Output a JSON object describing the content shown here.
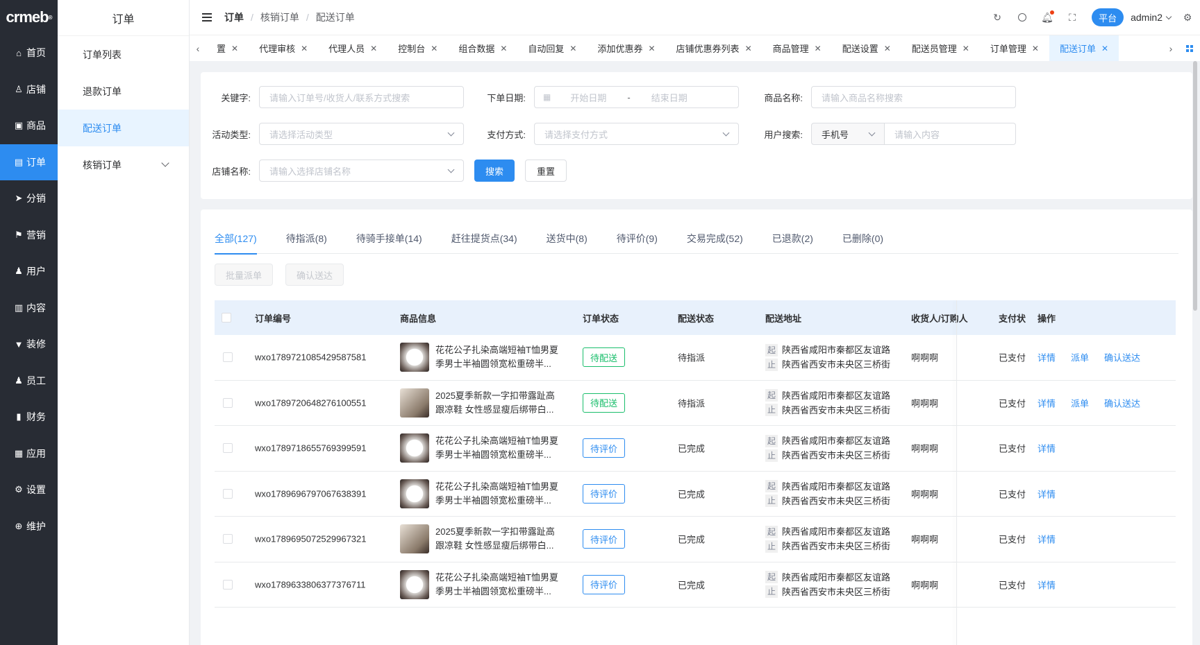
{
  "logo": "crmeb",
  "nav1": [
    {
      "label": "首页",
      "icon": "home-icon",
      "glyph": "⌂"
    },
    {
      "label": "店铺",
      "icon": "store-icon",
      "glyph": "♙"
    },
    {
      "label": "商品",
      "icon": "goods-icon",
      "glyph": "▣"
    },
    {
      "label": "订单",
      "icon": "order-icon",
      "glyph": "▤",
      "active": true
    },
    {
      "label": "分销",
      "icon": "distribution-icon",
      "glyph": "➤"
    },
    {
      "label": "营销",
      "icon": "flag-icon",
      "glyph": "⚑"
    },
    {
      "label": "用户",
      "icon": "user-icon",
      "glyph": "♟"
    },
    {
      "label": "内容",
      "icon": "book-icon",
      "glyph": "▥"
    },
    {
      "label": "装修",
      "icon": "brush-icon",
      "glyph": "▼"
    },
    {
      "label": "员工",
      "icon": "staff-icon",
      "glyph": "♟"
    },
    {
      "label": "财务",
      "icon": "chart-icon",
      "glyph": "▮"
    },
    {
      "label": "应用",
      "icon": "apps-icon",
      "glyph": "▦"
    },
    {
      "label": "设置",
      "icon": "gear-icon",
      "glyph": "⚙"
    },
    {
      "label": "维护",
      "icon": "maintain-icon",
      "glyph": "⊕"
    }
  ],
  "nav2": {
    "title": "订单",
    "items": [
      {
        "label": "订单列表"
      },
      {
        "label": "退款订单"
      },
      {
        "label": "配送订单",
        "active": true
      },
      {
        "label": "核销订单",
        "expandable": true
      }
    ]
  },
  "breadcrumb": [
    "订单",
    "核销订单",
    "配送订单"
  ],
  "header": {
    "platform": "平台",
    "user": "admin2"
  },
  "tabs": [
    {
      "label": "置"
    },
    {
      "label": "代理审核"
    },
    {
      "label": "代理人员"
    },
    {
      "label": "控制台"
    },
    {
      "label": "组合数据"
    },
    {
      "label": "自动回复"
    },
    {
      "label": "添加优惠券"
    },
    {
      "label": "店铺优惠券列表"
    },
    {
      "label": "商品管理"
    },
    {
      "label": "配送设置"
    },
    {
      "label": "配送员管理"
    },
    {
      "label": "订单管理"
    },
    {
      "label": "配送订单",
      "active": true
    }
  ],
  "filters": {
    "keyword_label": "关键字:",
    "keyword_placeholder": "请输入订单号/收货人/联系方式搜索",
    "date_label": "下单日期:",
    "date_start": "开始日期",
    "date_sep": "-",
    "date_end": "结束日期",
    "goods_label": "商品名称:",
    "goods_placeholder": "请输入商品名称搜索",
    "activity_label": "活动类型:",
    "activity_placeholder": "请选择活动类型",
    "pay_label": "支付方式:",
    "pay_placeholder": "请选择支付方式",
    "user_label": "用户搜索:",
    "user_type": "手机号",
    "user_placeholder": "请输入内容",
    "store_label": "店铺名称:",
    "store_placeholder": "请输入选择店铺名称",
    "search_btn": "搜索",
    "reset_btn": "重置"
  },
  "status_tabs": [
    {
      "label": "全部(127)",
      "active": true
    },
    {
      "label": "待指派(8)"
    },
    {
      "label": "待骑手接单(14)"
    },
    {
      "label": "赶往提货点(34)"
    },
    {
      "label": "送货中(8)"
    },
    {
      "label": "待评价(9)"
    },
    {
      "label": "交易完成(52)"
    },
    {
      "label": "已退款(2)"
    },
    {
      "label": "已删除(0)"
    }
  ],
  "batch": {
    "dispatch": "批量派单",
    "confirm": "确认送达"
  },
  "columns": [
    "订单编号",
    "商品信息",
    "订单状态",
    "配送状态",
    "配送地址",
    "收货人/订购人",
    "支付状",
    "操作"
  ],
  "rows": [
    {
      "id": "wxo1789721085429587581",
      "img": "shirt",
      "name1": "花花公子扎染高端短袖T恤男夏",
      "name2": "季男士半袖圆领宽松重磅半...",
      "status": "待配送",
      "status_color": "green",
      "delivery": "待指派",
      "from_tag": "起",
      "from": "陕西省咸阳市秦都区友谊路",
      "to_tag": "止",
      "to": "陕西省西安市未央区三桥街",
      "buyer": "啊啊啊",
      "pay": "已支付",
      "ops": [
        "详情",
        "派单",
        "确认送达"
      ]
    },
    {
      "id": "wxo1789720648276100551",
      "img": "shoe",
      "name1": "2025夏季新款一字扣带露趾高",
      "name2": "跟凉鞋 女性感显瘦后绑带白...",
      "status": "待配送",
      "status_color": "green",
      "delivery": "待指派",
      "from_tag": "起",
      "from": "陕西省咸阳市秦都区友谊路",
      "to_tag": "止",
      "to": "陕西省西安市未央区三桥街",
      "buyer": "啊啊啊",
      "pay": "已支付",
      "ops": [
        "详情",
        "派单",
        "确认送达"
      ]
    },
    {
      "id": "wxo1789718655769399591",
      "img": "shirt",
      "name1": "花花公子扎染高端短袖T恤男夏",
      "name2": "季男士半袖圆领宽松重磅半...",
      "status": "待评价",
      "status_color": "blue",
      "delivery": "已完成",
      "from_tag": "起",
      "from": "陕西省咸阳市秦都区友谊路",
      "to_tag": "止",
      "to": "陕西省西安市未央区三桥街",
      "buyer": "啊啊啊",
      "pay": "已支付",
      "ops": [
        "详情"
      ]
    },
    {
      "id": "wxo1789696797067638391",
      "img": "shirt",
      "name1": "花花公子扎染高端短袖T恤男夏",
      "name2": "季男士半袖圆领宽松重磅半...",
      "status": "待评价",
      "status_color": "blue",
      "delivery": "已完成",
      "from_tag": "起",
      "from": "陕西省咸阳市秦都区友谊路",
      "to_tag": "止",
      "to": "陕西省西安市未央区三桥街",
      "buyer": "啊啊啊",
      "pay": "已支付",
      "ops": [
        "详情"
      ]
    },
    {
      "id": "wxo1789695072529967321",
      "img": "shoe",
      "name1": "2025夏季新款一字扣带露趾高",
      "name2": "跟凉鞋 女性感显瘦后绑带白...",
      "status": "待评价",
      "status_color": "blue",
      "delivery": "已完成",
      "from_tag": "起",
      "from": "陕西省咸阳市秦都区友谊路",
      "to_tag": "止",
      "to": "陕西省西安市未央区三桥街",
      "buyer": "啊啊啊",
      "pay": "已支付",
      "ops": [
        "详情"
      ]
    },
    {
      "id": "wxo1789633806377376711",
      "img": "shirt",
      "name1": "花花公子扎染高端短袖T恤男夏",
      "name2": "季男士半袖圆领宽松重磅半...",
      "status": "待评价",
      "status_color": "blue",
      "delivery": "已完成",
      "from_tag": "起",
      "from": "陕西省咸阳市秦都区友谊路",
      "to_tag": "止",
      "to": "陕西省西安市未央区三桥街",
      "buyer": "啊啊啊",
      "pay": "已支付",
      "ops": [
        "详情"
      ]
    }
  ]
}
